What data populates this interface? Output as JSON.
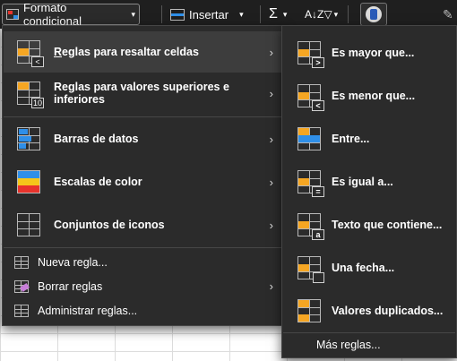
{
  "ribbon": {
    "format_label": "Formato condicional",
    "insert_label": "Insertar",
    "sum_symbol": "Σ",
    "sort_symbol": "A↓Z▽"
  },
  "menu": {
    "items": [
      {
        "label": "Reglas para resaltar celdas",
        "has_submenu": true
      },
      {
        "label": "Reglas para valores superiores e inferiores",
        "has_submenu": true
      },
      {
        "label": "Barras de datos",
        "has_submenu": true
      },
      {
        "label": "Escalas de color",
        "has_submenu": true
      },
      {
        "label": "Conjuntos de iconos",
        "has_submenu": true
      },
      {
        "label": "Nueva regla...",
        "has_submenu": false
      },
      {
        "label": "Borrar reglas",
        "has_submenu": true
      },
      {
        "label": "Administrar reglas...",
        "has_submenu": false
      }
    ],
    "badge_gt": ">",
    "badge_lt": "<",
    "badge_10": "10"
  },
  "submenu": {
    "items": [
      {
        "label": "Es mayor que...",
        "badge": ">"
      },
      {
        "label": "Es menor que...",
        "badge": "<"
      },
      {
        "label": "Entre...",
        "badge": ""
      },
      {
        "label": "Es igual a...",
        "badge": "="
      },
      {
        "label": "Texto que contiene...",
        "badge": "a"
      },
      {
        "label": "Una fecha...",
        "badge": ""
      },
      {
        "label": "Valores duplicados...",
        "badge": ""
      }
    ],
    "more_label": "Más reglas..."
  },
  "colors": {
    "orange": "#f5a623",
    "blue": "#2f8fe8",
    "red": "#e8332c",
    "menu_bg": "#2b2b2b"
  },
  "arrow": "›",
  "chevron": "⌄"
}
